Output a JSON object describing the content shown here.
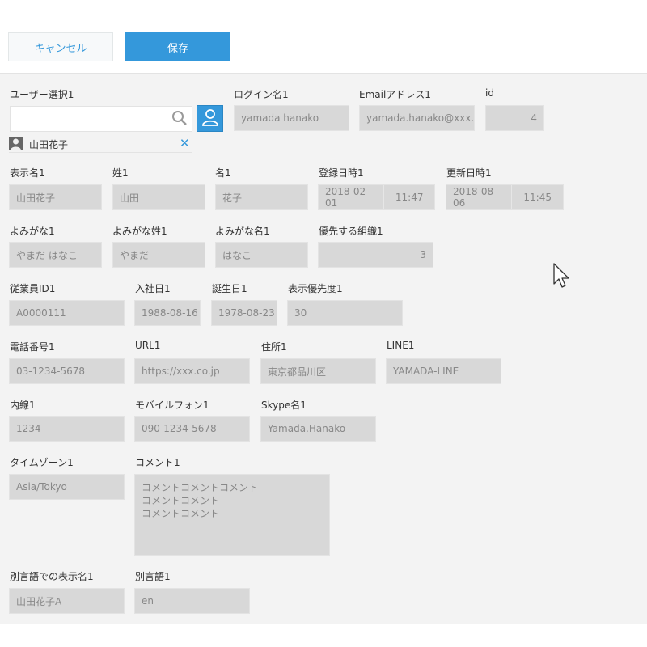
{
  "toolbar": {
    "cancel_label": "キャンセル",
    "save_label": "保存"
  },
  "form": {
    "user_select": {
      "label": "ユーザー選択1",
      "input_value": "",
      "selected_user": "山田花子"
    },
    "login_name": {
      "label": "ログイン名1",
      "value": "yamada hanako"
    },
    "email": {
      "label": "Emailアドレス1",
      "value": "yamada.hanako@xxx.c"
    },
    "id": {
      "label": "id",
      "value": "4"
    },
    "display_name": {
      "label": "表示名1",
      "value": "山田花子"
    },
    "surname": {
      "label": "姓1",
      "value": "山田"
    },
    "given_name": {
      "label": "名1",
      "value": "花子"
    },
    "created_at": {
      "label": "登録日時1",
      "date": "2018-02-01",
      "time": "11:47"
    },
    "updated_at": {
      "label": "更新日時1",
      "date": "2018-08-06",
      "time": "11:45"
    },
    "yomigana": {
      "label": "よみがな1",
      "value": "やまだ はなこ"
    },
    "yomigana_surname": {
      "label": "よみがな姓1",
      "value": "やまだ"
    },
    "yomigana_given": {
      "label": "よみがな名1",
      "value": "はなこ"
    },
    "priority_org": {
      "label": "優先する組織1",
      "value": "3"
    },
    "employee_id": {
      "label": "従業員ID1",
      "value": "A0000111"
    },
    "join_date": {
      "label": "入社日1",
      "value": "1988-08-16"
    },
    "birthday": {
      "label": "誕生日1",
      "value": "1978-08-23"
    },
    "display_priority": {
      "label": "表示優先度1",
      "value": "30"
    },
    "phone": {
      "label": "電話番号1",
      "value": "03-1234-5678"
    },
    "url": {
      "label": "URL1",
      "value": "https://xxx.co.jp"
    },
    "address": {
      "label": "住所1",
      "value": "東京都品川区"
    },
    "line": {
      "label": "LINE1",
      "value": "YAMADA-LINE"
    },
    "extension": {
      "label": "内線1",
      "value": "1234"
    },
    "mobile": {
      "label": "モバイルフォン1",
      "value": "090-1234-5678"
    },
    "skype": {
      "label": "Skype名1",
      "value": "Yamada.Hanako"
    },
    "timezone": {
      "label": "タイムゾーン1",
      "value": "Asia/Tokyo"
    },
    "comment": {
      "label": "コメント1",
      "lines": [
        "コメントコメントコメント",
        "コメントコメント",
        "コメントコメント"
      ]
    },
    "alt_display_name": {
      "label": "別言語での表示名1",
      "value": "山田花子A"
    },
    "alt_language": {
      "label": "別言語1",
      "value": "en"
    }
  },
  "colors": {
    "accent": "#3498db",
    "form_bg": "#f3f3f3",
    "field_bg": "#d8d8d8"
  },
  "icons": [
    "search-icon",
    "user-icon",
    "avatar-icon",
    "close-icon",
    "mouse-cursor-icon"
  ]
}
